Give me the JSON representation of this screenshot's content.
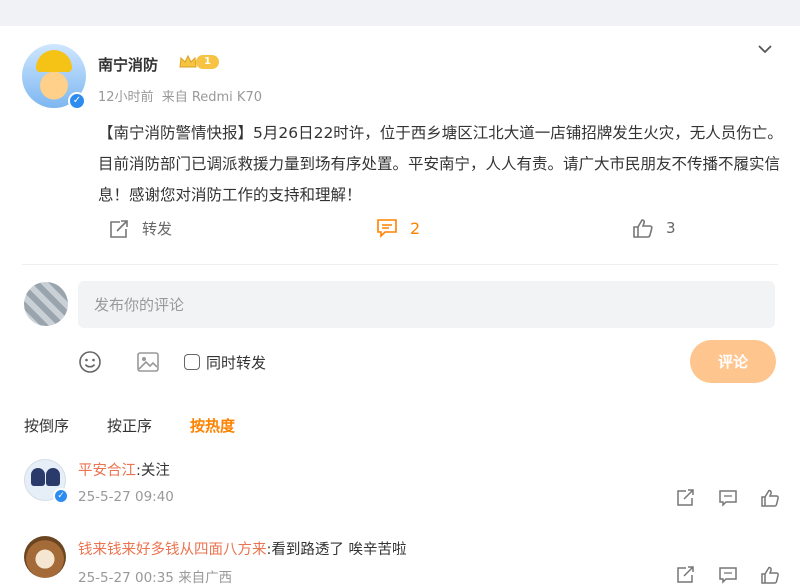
{
  "post": {
    "author": "南宁消防",
    "level_badge": "1",
    "time": "12小时前",
    "source": "来自 Redmi K70",
    "text": "【南宁消防警情快报】5月26日22时许，位于西乡塘区江北大道一店铺招牌发生火灾，无人员伤亡。目前消防部门已调派救援力量到场有序处置。平安南宁，人人有责。请广大市民朋友不传播不履实信息！感谢您对消防工作的支持和理解！",
    "repost_label": "转发",
    "comment_count": "2",
    "like_count": "3"
  },
  "composer": {
    "placeholder": "发布你的评论",
    "sync_label": "同时转发",
    "submit_label": "评论"
  },
  "sort": {
    "by_time_desc": "按倒序",
    "by_time_asc": "按正序",
    "by_hot": "按热度"
  },
  "comments": [
    {
      "nick": "平安合江",
      "text": ":关注",
      "time": "25-5-27 09:40",
      "location": ""
    },
    {
      "nick": "钱来钱来好多钱从四面八方来",
      "text": ":看到路透了 唉辛苦啦",
      "time": "25-5-27 00:35",
      "location": "来自广西"
    }
  ],
  "colors": {
    "accent": "#ff8200",
    "nick": "#eb7350",
    "submit_bg": "#ffc58e",
    "verify": "#2d8cf0"
  }
}
